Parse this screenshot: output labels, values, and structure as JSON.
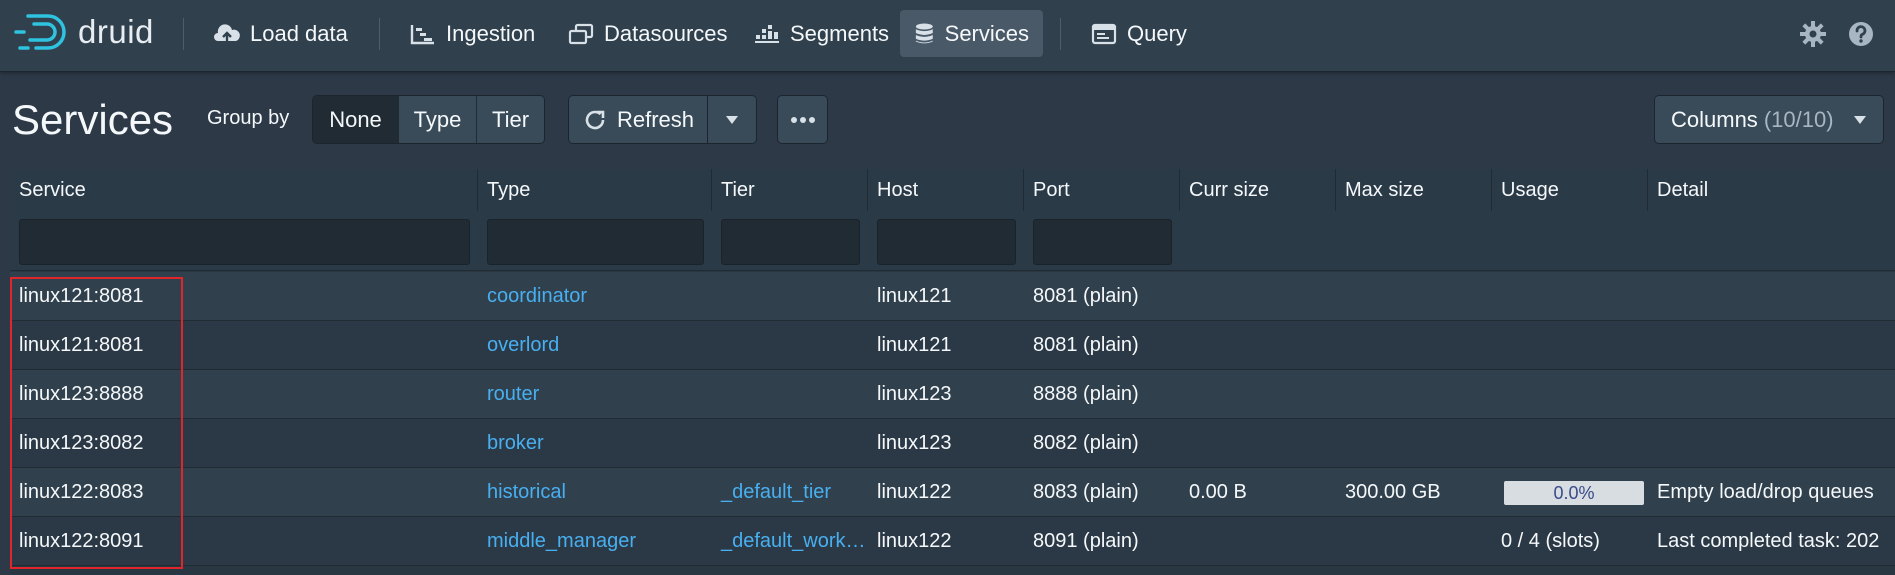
{
  "app": {
    "logo_text": "druid"
  },
  "nav": {
    "load_data": "Load data",
    "ingestion": "Ingestion",
    "datasources": "Datasources",
    "segments": "Segments",
    "services": "Services",
    "query": "Query"
  },
  "page": {
    "title": "Services",
    "group_by_label": "Group by",
    "group_options": [
      "None",
      "Type",
      "Tier"
    ],
    "group_selected": "None",
    "refresh_label": "Refresh",
    "columns_label": "Columns",
    "columns_count": "(10/10)"
  },
  "table": {
    "columns": [
      "Service",
      "Type",
      "Tier",
      "Host",
      "Port",
      "Curr size",
      "Max size",
      "Usage",
      "Detail"
    ],
    "rows": [
      {
        "service": "linux121:8081",
        "type": "coordinator",
        "tier": "",
        "host": "linux121",
        "port": "8081 (plain)",
        "curr_size": "",
        "max_size": "",
        "usage": "",
        "detail": ""
      },
      {
        "service": "linux121:8081",
        "type": "overlord",
        "tier": "",
        "host": "linux121",
        "port": "8081 (plain)",
        "curr_size": "",
        "max_size": "",
        "usage": "",
        "detail": ""
      },
      {
        "service": "linux123:8888",
        "type": "router",
        "tier": "",
        "host": "linux123",
        "port": "8888 (plain)",
        "curr_size": "",
        "max_size": "",
        "usage": "",
        "detail": ""
      },
      {
        "service": "linux123:8082",
        "type": "broker",
        "tier": "",
        "host": "linux123",
        "port": "8082 (plain)",
        "curr_size": "",
        "max_size": "",
        "usage": "",
        "detail": ""
      },
      {
        "service": "linux122:8083",
        "type": "historical",
        "tier": "_default_tier",
        "host": "linux122",
        "port": "8083 (plain)",
        "curr_size": "0.00 B",
        "max_size": "300.00 GB",
        "usage": "0.0%",
        "usage_fraction": 0.0,
        "detail": "Empty load/drop queues"
      },
      {
        "service": "linux122:8091",
        "type": "middle_manager",
        "tier": "_default_work…",
        "host": "linux122",
        "port": "8091 (plain)",
        "curr_size": "",
        "max_size": "",
        "usage": "0 / 4 (slots)",
        "detail": "Last completed task: 202"
      }
    ]
  },
  "colors": {
    "link": "#48aff0",
    "highlight_box": "#e0262b",
    "navbar": "#30404d",
    "background": "#2d3947"
  }
}
